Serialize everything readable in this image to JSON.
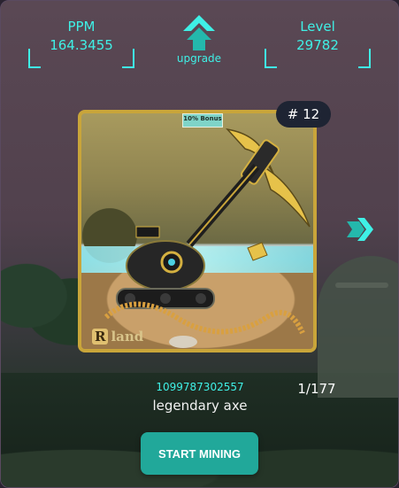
{
  "stats": {
    "ppm": {
      "label": "PPM",
      "value": "164.3455"
    },
    "level": {
      "label": "Level",
      "value": "29782"
    }
  },
  "upgrade": {
    "label": "upgrade",
    "icon": "double-chevron-up-icon"
  },
  "card": {
    "bonus_text": "10% Bonus",
    "number": "# 12",
    "brand": "R land",
    "brand_letter": "R",
    "brand_word": "land"
  },
  "next_icon": "double-chevron-right-icon",
  "item": {
    "token_id": "1099787302557",
    "name": "legendary axe",
    "counter": "1/177"
  },
  "actions": {
    "start_mining": "START MINING"
  },
  "colors": {
    "accent": "#3ff0e6",
    "button": "#21a89a",
    "badge": "#1e2433",
    "frame": "#c9a53a"
  }
}
